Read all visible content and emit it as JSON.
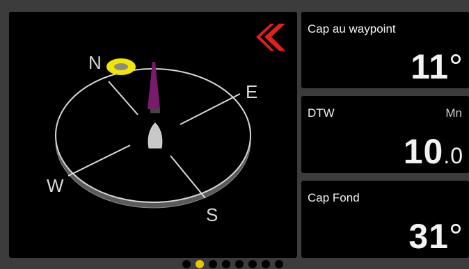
{
  "compass": {
    "directions": {
      "north": "N",
      "east": "E",
      "south": "S",
      "west": "W"
    },
    "heading_marker_color": "#7a1a6e",
    "waypoint_marker_color": "#f2e500",
    "back_arrow_color": "#e21e1e"
  },
  "panels": [
    {
      "label": "Cap au waypoint",
      "unit": "",
      "value_int": "11",
      "value_dec": "",
      "suffix": "°"
    },
    {
      "label": "DTW",
      "unit": "Mn",
      "value_int": "10",
      "value_dec": ".0",
      "suffix": ""
    },
    {
      "label": "Cap Fond",
      "unit": "",
      "value_int": "31",
      "value_dec": "",
      "suffix": "°"
    }
  ],
  "pagination": {
    "total": 8,
    "active_index": 1
  }
}
